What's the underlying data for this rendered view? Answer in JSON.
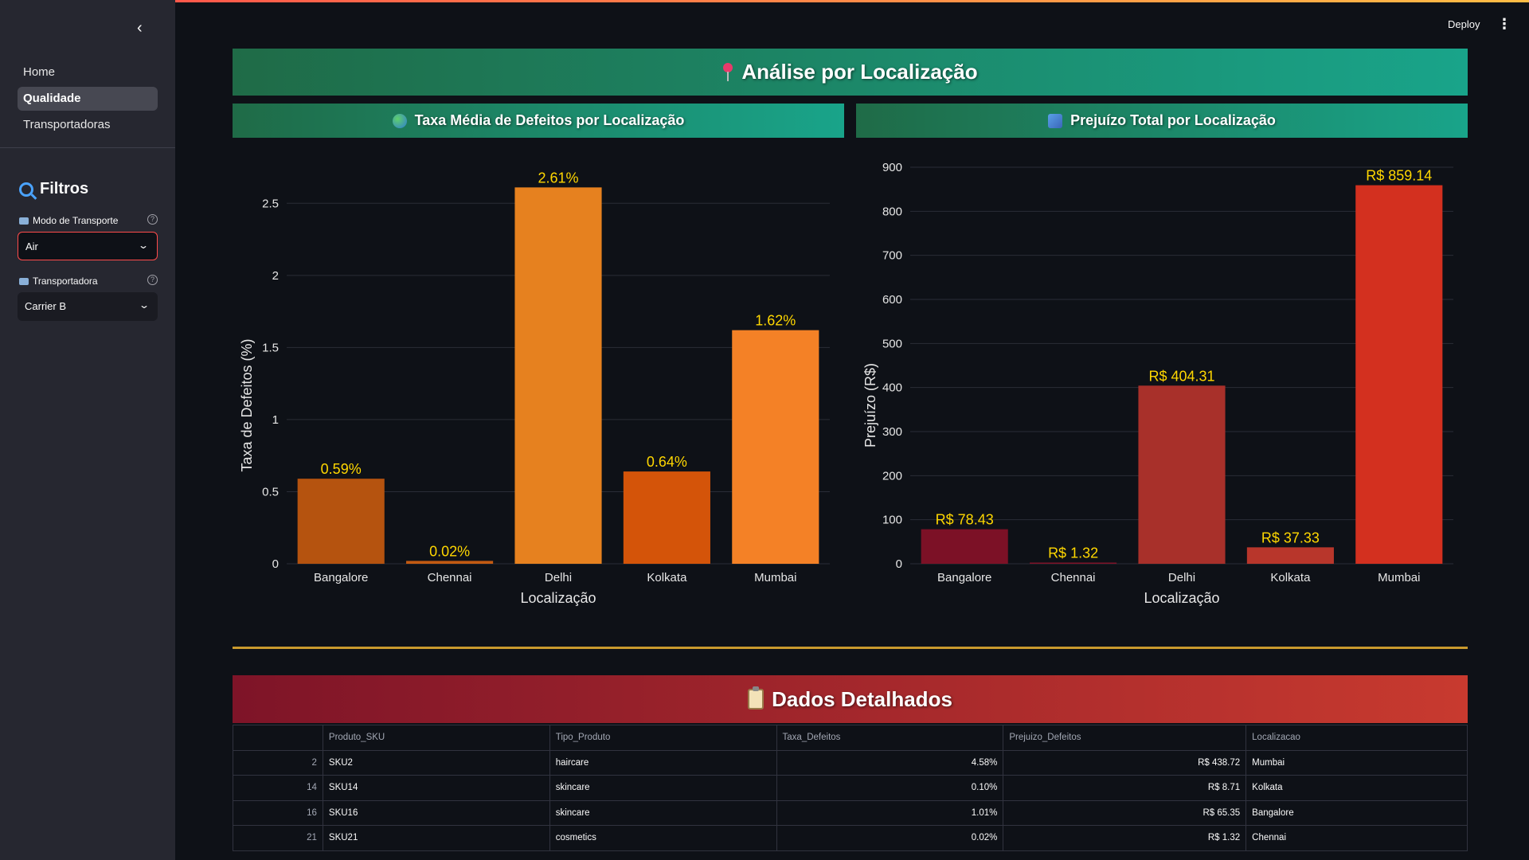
{
  "sidebar": {
    "nav": [
      {
        "label": "Home",
        "active": false
      },
      {
        "label": "Qualidade",
        "active": true
      },
      {
        "label": "Transportadoras",
        "active": false
      }
    ],
    "filters_title": "Filtros",
    "filters": [
      {
        "label": "Modo de Transporte",
        "value": "Air"
      },
      {
        "label": "Transportadora",
        "value": "Carrier B"
      }
    ]
  },
  "header": {
    "deploy_label": "Deploy"
  },
  "main": {
    "title": "Análise por Localização",
    "chart1_title": "Taxa Média de Defeitos por Localização",
    "chart2_title": "Prejuízo Total por Localização",
    "table_title": "Dados Detalhados"
  },
  "colors": {
    "label_gold": "#ffd700",
    "table_gold_line": "#c99a2e"
  },
  "chart_data": [
    {
      "type": "bar",
      "title": "Taxa Média de Defeitos por Localização",
      "categories": [
        "Bangalore",
        "Chennai",
        "Delhi",
        "Kolkata",
        "Mumbai"
      ],
      "values": [
        0.59,
        0.02,
        2.61,
        0.64,
        1.62
      ],
      "data_labels": [
        "0.59%",
        "0.02%",
        "2.61%",
        "0.64%",
        "1.62%"
      ],
      "colors": [
        "#b5530f",
        "#c25a12",
        "#e6811f",
        "#d45409",
        "#f48126"
      ],
      "xlabel": "Localização",
      "ylabel": "Taxa de Defeitos (%)",
      "ylim": [
        0,
        2.75
      ],
      "yticks": [
        0,
        0.5,
        1,
        1.5,
        2,
        2.5
      ],
      "ytick_labels": [
        "0",
        "0.5",
        "1",
        "1.5",
        "2",
        "2.5"
      ],
      "grid": true
    },
    {
      "type": "bar",
      "title": "Prejuízo Total por Localização",
      "categories": [
        "Bangalore",
        "Chennai",
        "Delhi",
        "Kolkata",
        "Mumbai"
      ],
      "values": [
        78.43,
        1.32,
        404.31,
        37.33,
        859.14
      ],
      "data_labels": [
        "R$ 78.43",
        "R$ 1.32",
        "R$ 404.31",
        "R$ 37.33",
        "R$ 859.14"
      ],
      "colors": [
        "#7c1126",
        "#7e1328",
        "#a8302a",
        "#b8362b",
        "#d3301f"
      ],
      "xlabel": "Localização",
      "ylabel": "Prejuízo (R$)",
      "ylim": [
        0,
        900
      ],
      "yticks": [
        0,
        100,
        200,
        300,
        400,
        500,
        600,
        700,
        800,
        900
      ],
      "ytick_labels": [
        "0",
        "100",
        "200",
        "300",
        "400",
        "500",
        "600",
        "700",
        "800",
        "900"
      ],
      "grid": true
    }
  ],
  "table": {
    "columns": [
      "Produto_SKU",
      "Tipo_Produto",
      "Taxa_Defeitos",
      "Prejuizo_Defeitos",
      "Localizacao"
    ],
    "rows": [
      {
        "idx": "2",
        "cells": [
          "SKU2",
          "haircare",
          "4.58%",
          "R$ 438.72",
          "Mumbai"
        ]
      },
      {
        "idx": "14",
        "cells": [
          "SKU14",
          "skincare",
          "0.10%",
          "R$ 8.71",
          "Kolkata"
        ]
      },
      {
        "idx": "16",
        "cells": [
          "SKU16",
          "skincare",
          "1.01%",
          "R$ 65.35",
          "Bangalore"
        ]
      },
      {
        "idx": "21",
        "cells": [
          "SKU21",
          "cosmetics",
          "0.02%",
          "R$ 1.32",
          "Chennai"
        ]
      }
    ]
  }
}
